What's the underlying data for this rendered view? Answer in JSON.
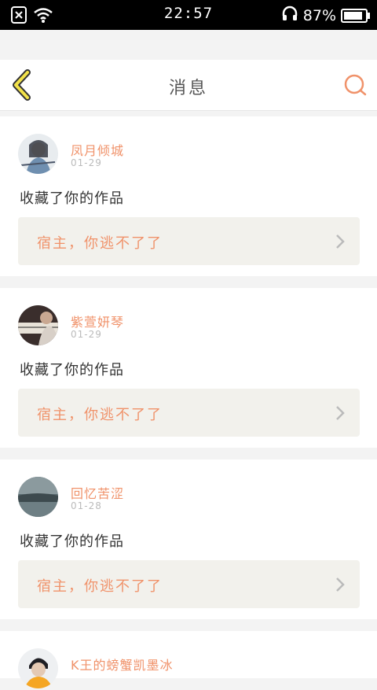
{
  "status_bar": {
    "time": "22:57",
    "battery_percent": "87%",
    "battery_level": 0.87,
    "icons": [
      "sim-off-icon",
      "wifi-icon",
      "headphones-icon",
      "battery-icon"
    ]
  },
  "header": {
    "title": "消息",
    "back_icon": "chevron-left-icon",
    "search_icon": "search-icon",
    "accent_color": "#f0926a"
  },
  "messages": [
    {
      "user": "凤月倾城",
      "date": "01-29",
      "action": "收藏了你的作品",
      "work": "宿主，你逃不了了"
    },
    {
      "user": "紫萱妍琴",
      "date": "01-29",
      "action": "收藏了你的作品",
      "work": "宿主，你逃不了了"
    },
    {
      "user": "回忆苦涩",
      "date": "01-28",
      "action": "收藏了你的作品",
      "work": "宿主，你逃不了了"
    },
    {
      "user": "K王的螃蟹凯墨冰"
    }
  ]
}
